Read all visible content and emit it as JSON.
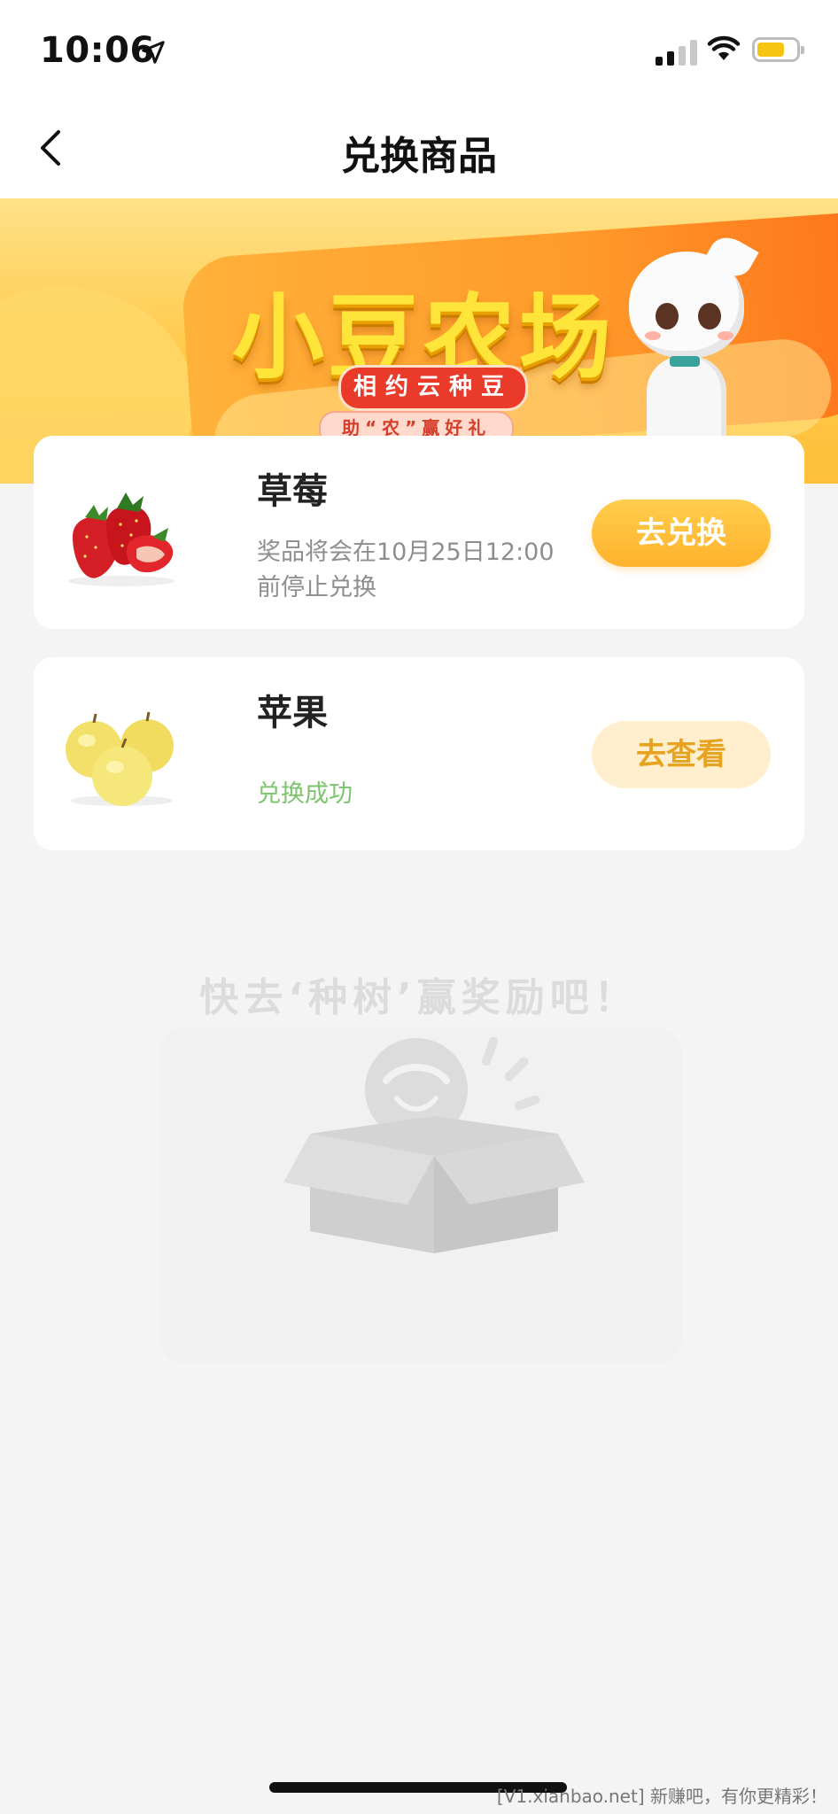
{
  "status_bar": {
    "time": "10:06",
    "battery_color": "#f6c514"
  },
  "nav": {
    "back_icon": "chevron-left-icon",
    "title": "兑换商品"
  },
  "banner": {
    "title": "小豆农场",
    "subtitle": "相约云种豆",
    "tagline": "助“农”赢好礼"
  },
  "products": [
    {
      "name": "草莓",
      "description": "奖品将会在10月25日12:00前停止兑换",
      "button_label": "去兑换",
      "image_icon": "strawberry-icon"
    },
    {
      "name": "苹果",
      "status": "兑换成功",
      "button_label": "去查看",
      "image_icon": "apple-icon"
    }
  ],
  "empty_state": {
    "message": "快去‘种树’赢奖励吧！"
  },
  "watermark": "[V1.xianbao.net] 新赚吧，有你更精彩！",
  "colors": {
    "accent": "#ffb22d",
    "success": "#7cc56e",
    "background": "#f4f4f4"
  }
}
